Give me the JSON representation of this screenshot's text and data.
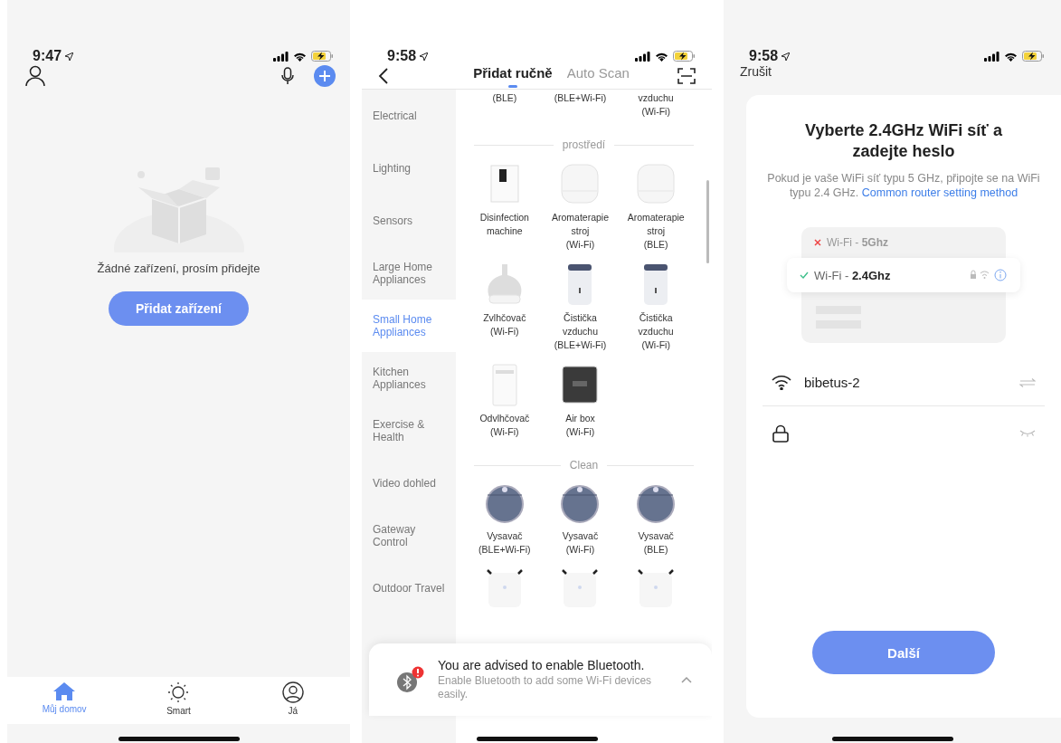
{
  "home_screen": {
    "time": "9:47",
    "empty_text": "Žádné zařízení, prosím přidejte",
    "add_button": "Přidat zařízení",
    "tabs": [
      {
        "kind": "home",
        "label": "Můj domov",
        "selected": true
      },
      {
        "kind": "smart",
        "label": "Smart",
        "selected": false
      },
      {
        "kind": "me",
        "label": "Já",
        "selected": false
      }
    ]
  },
  "add_device_screen": {
    "time": "9:58",
    "tabs": [
      {
        "label": "Přidat ručně",
        "selected": true
      },
      {
        "label": "Auto Scan",
        "selected": false
      }
    ],
    "categories": [
      {
        "label": "Electrical",
        "selected": false
      },
      {
        "label": "Lighting",
        "selected": false
      },
      {
        "label": "Sensors",
        "selected": false
      },
      {
        "label": "Large Home Appliances",
        "selected": false
      },
      {
        "label": "Small Home Appliances",
        "selected": true
      },
      {
        "label": "Kitchen Appliances",
        "selected": false
      },
      {
        "label": "Exercise & Health",
        "selected": false
      },
      {
        "label": "Video dohled",
        "selected": false
      },
      {
        "label": "Gateway Control",
        "selected": false
      },
      {
        "label": "Outdoor Travel",
        "selected": false
      }
    ],
    "sections": [
      {
        "items": [
          {
            "kind": "cut",
            "lines": [
              "(BLE)"
            ]
          },
          {
            "kind": "cut",
            "lines": [
              "(BLE+Wi-Fi)"
            ]
          },
          {
            "kind": "cut",
            "lines": [
              "vzduchu",
              "(Wi-Fi)"
            ]
          }
        ]
      },
      {
        "title": "prostředí",
        "items": [
          {
            "kind": "disinfector",
            "lines": [
              "Disinfection",
              "machine"
            ]
          },
          {
            "kind": "aroma",
            "lines": [
              "Aromaterapie",
              "stroj",
              "(Wi-Fi)"
            ]
          },
          {
            "kind": "aroma",
            "lines": [
              "Aromaterapie",
              "stroj",
              "(BLE)"
            ]
          },
          {
            "kind": "humidifier",
            "lines": [
              "Zvlhčovač",
              "(Wi-Fi)"
            ]
          },
          {
            "kind": "purifier",
            "lines": [
              "Čistička",
              "vzduchu",
              "(BLE+Wi-Fi)"
            ]
          },
          {
            "kind": "purifier",
            "lines": [
              "Čistička",
              "vzduchu",
              "(Wi-Fi)"
            ]
          },
          {
            "kind": "dehumidifier",
            "lines": [
              "Odvlhčovač",
              "(Wi-Fi)"
            ]
          },
          {
            "kind": "airbox",
            "lines": [
              "Air box",
              "(Wi-Fi)"
            ]
          }
        ]
      },
      {
        "title": "Clean",
        "items": [
          {
            "kind": "vacuum",
            "lines": [
              "Vysavač",
              "(BLE+Wi-Fi)"
            ]
          },
          {
            "kind": "vacuum",
            "lines": [
              "Vysavač",
              "(Wi-Fi)"
            ]
          },
          {
            "kind": "vacuum",
            "lines": [
              "Vysavač",
              "(BLE)"
            ]
          },
          {
            "kind": "window-robot"
          },
          {
            "kind": "window-robot"
          },
          {
            "kind": "window-robot"
          }
        ]
      }
    ],
    "banner": {
      "title": "You are advised to enable Bluetooth.",
      "text": "Enable Bluetooth to add some Wi-Fi devices easily."
    }
  },
  "wifi_screen": {
    "time": "9:58",
    "cancel": "Zrušit",
    "title": "Vyberte 2.4GHz WiFi síť a zadejte heslo",
    "description": "Pokud je vaše WiFi síť typu 5 GHz, připojte se na WiFi typu 2.4 GHz.",
    "link": "Common router setting method",
    "networks": [
      {
        "label": "Wi-Fi - **5Ghz**",
        "selected": false
      },
      {
        "label": "Wi-Fi - **2.4Ghz**",
        "selected": true
      }
    ],
    "ssid": "bibetus-2",
    "next_button": "Další"
  }
}
